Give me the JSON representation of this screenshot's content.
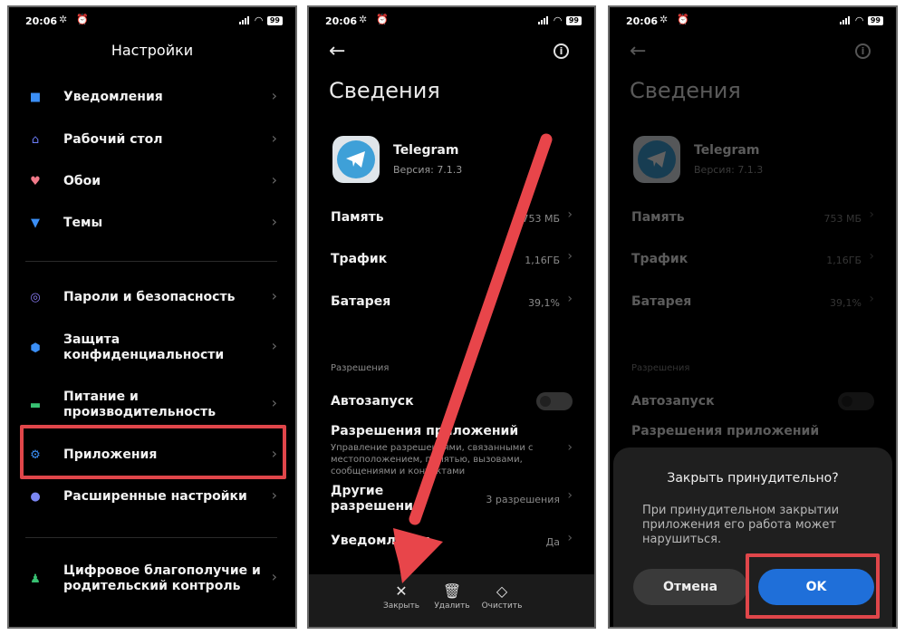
{
  "status": {
    "time": "20:06",
    "battery": "99"
  },
  "settings": {
    "title": "Настройки",
    "items": [
      {
        "label": "Уведомления",
        "icon": "notifications-icon",
        "color": "#3b8ff6"
      },
      {
        "label": "Рабочий стол",
        "icon": "home-icon",
        "color": "#6b7cf5"
      },
      {
        "label": "Обои",
        "icon": "wallpaper-icon",
        "color": "#f27a8a"
      },
      {
        "label": "Темы",
        "icon": "themes-icon",
        "color": "#3b8ff6"
      },
      {
        "label": "Пароли и безопасность",
        "icon": "fingerprint-icon",
        "color": "#8a7cf5"
      },
      {
        "label": "Защита конфиденциальности",
        "icon": "privacy-icon",
        "color": "#3b8ff6"
      },
      {
        "label": "Питание и производительность",
        "icon": "battery-icon",
        "color": "#38c172"
      },
      {
        "label": "Приложения",
        "icon": "gear-icon",
        "color": "#3b8ff6"
      },
      {
        "label": "Расширенные настройки",
        "icon": "more-icon",
        "color": "#7a86f2"
      },
      {
        "label": "Цифровое благополучие и родительский контроль",
        "icon": "wellbeing-icon",
        "color": "#38c172"
      }
    ]
  },
  "app_info": {
    "title": "Сведения",
    "app_name": "Telegram",
    "version": "Версия: 7.1.3",
    "rows": {
      "memory": {
        "label": "Память",
        "value": "753 МБ"
      },
      "traffic": {
        "label": "Трафик",
        "value": "1,16ГБ"
      },
      "battery": {
        "label": "Батарея",
        "value": "39,1%"
      }
    },
    "section": "Разрешения",
    "autostart": "Автозапуск",
    "app_permissions": "Разрешения приложений",
    "app_permissions_sub": "Управление разрешениями, связанными с местоположением, памятью, вызовами, сообщениями и контактами",
    "other_permissions": "Другие разрешения",
    "other_permissions_value": "3 разрешения",
    "notifications": "Уведомления",
    "notifications_value": "Да",
    "bottom": {
      "close": "Закрыть",
      "delete": "Удалить",
      "clear": "Очистить"
    }
  },
  "dialog": {
    "title": "Закрыть принудительно?",
    "message": "При принудительном закрытии приложения его работа может нарушиться.",
    "cancel": "Отмена",
    "ok": "OK"
  },
  "colors": {
    "highlight": "#e0464a",
    "ok_button": "#1f6fd9",
    "arrow": "#e8454a"
  }
}
